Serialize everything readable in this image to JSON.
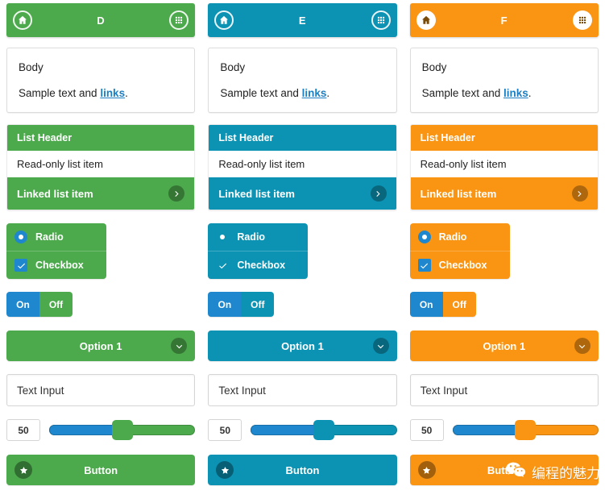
{
  "themes": {
    "green": {
      "name": "green",
      "accent": "#4CA94C",
      "accent_dark": "#3F9440",
      "icon_bg": "#4CA94C",
      "icon_fg": "#ffffff",
      "icon_ring": "#ffffff",
      "radio_bg": "#1E87CE",
      "check_bg": "#1E87CE"
    },
    "blue": {
      "name": "blue",
      "accent": "#0C93B4",
      "accent_dark": "#0A7F9C",
      "icon_bg": "#0C93B4",
      "icon_fg": "#ffffff",
      "icon_ring": "#ffffff",
      "radio_bg": "#0C93B4",
      "check_bg": "#0C93B4"
    },
    "orange": {
      "name": "orange",
      "accent": "#FA9413",
      "accent_dark": "#E8850B",
      "icon_bg": "#ffffff",
      "icon_fg": "#7A4A08",
      "icon_ring": "#ffffff",
      "radio_bg": "#1E87CE",
      "check_bg": "#1E87CE"
    }
  },
  "shared": {
    "toggle_on_color": "#1E87CE",
    "link_color": "#1B7FC4",
    "slider_fill_color": "#1E87CE",
    "header": {
      "home_icon": "home-icon",
      "grid_icon": "grid-icon"
    },
    "panel": {
      "title": "Body",
      "text_before": "Sample text and ",
      "link_label": "links",
      "text_after": "."
    },
    "list": {
      "header_label": "List Header",
      "readonly_label": "Read-only list item",
      "linked_label": "Linked list item",
      "linked_icon": "chevron-right-icon"
    },
    "choices": {
      "radio_label": "Radio",
      "radio_icon": "radio-selected-icon",
      "checkbox_label": "Checkbox",
      "checkbox_icon": "checkbox-checked-icon"
    },
    "segmented": {
      "on_label": "On",
      "off_label": "Off",
      "selected": "On"
    },
    "select": {
      "selected_option": "Option 1",
      "options": [
        "Option 1"
      ],
      "chevron_icon": "chevron-down-icon"
    },
    "text_input": {
      "value": "Text Input",
      "placeholder": "Text Input"
    },
    "slider": {
      "value": "50",
      "min": 0,
      "max": 100,
      "percent": 50
    },
    "button": {
      "label": "Button",
      "icon": "star-icon"
    }
  },
  "columns": [
    {
      "theme": "green",
      "header_title": "D"
    },
    {
      "theme": "blue",
      "header_title": "E"
    },
    {
      "theme": "orange",
      "header_title": "F"
    }
  ],
  "watermark": {
    "logo_icon": "wechat-icon",
    "text": "编程的魅力"
  }
}
